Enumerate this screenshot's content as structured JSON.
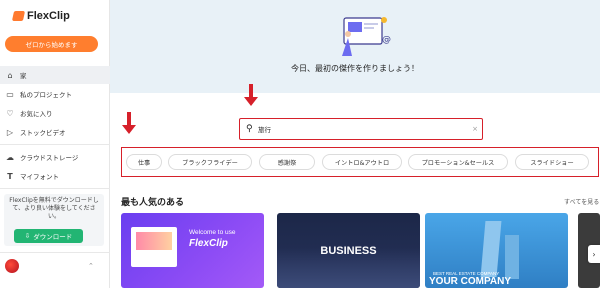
{
  "app": {
    "logo_text": "FlexClip"
  },
  "sidebar": {
    "start_button": "ゼロから始めます",
    "items": [
      {
        "label": "家",
        "icon": "home-icon",
        "active": true
      },
      {
        "label": "私のプロジェクト",
        "icon": "file-icon",
        "active": false
      },
      {
        "label": "お気に入り",
        "icon": "heart-icon",
        "active": false
      },
      {
        "label": "ストックビデオ",
        "icon": "play-icon",
        "active": false
      }
    ],
    "items2": [
      {
        "label": "クラウドストレージ",
        "icon": "cloud-icon"
      },
      {
        "label": "マイフォント",
        "icon": "font-icon"
      }
    ],
    "promo_text": "FlexClipを無料でダウンロードして、より良い体験をしてください。",
    "download_button": "ダウンロード"
  },
  "hero": {
    "text": "今日、最初の傑作を作りましょう！"
  },
  "search": {
    "value": "旅行",
    "clear": "×"
  },
  "tags": [
    "仕事",
    "ブラックフライデー",
    "感謝祭",
    "イントロ&アウトロ",
    "プロモーション&セールス",
    "スライドショー"
  ],
  "section": {
    "title": "最も人気のある",
    "see_all": "すべてを見る"
  },
  "cards": [
    {
      "line1": "Welcome to use",
      "line2": "FlexClip"
    },
    {
      "line1": "BUSINESS",
      "line2": ""
    },
    {
      "line1": "BEST REAL ESTATE COMPANY",
      "line2": "YOUR COMPANY"
    }
  ],
  "colors": {
    "accent": "#ff7e2e",
    "highlight": "#d6202a",
    "download": "#22b573"
  }
}
